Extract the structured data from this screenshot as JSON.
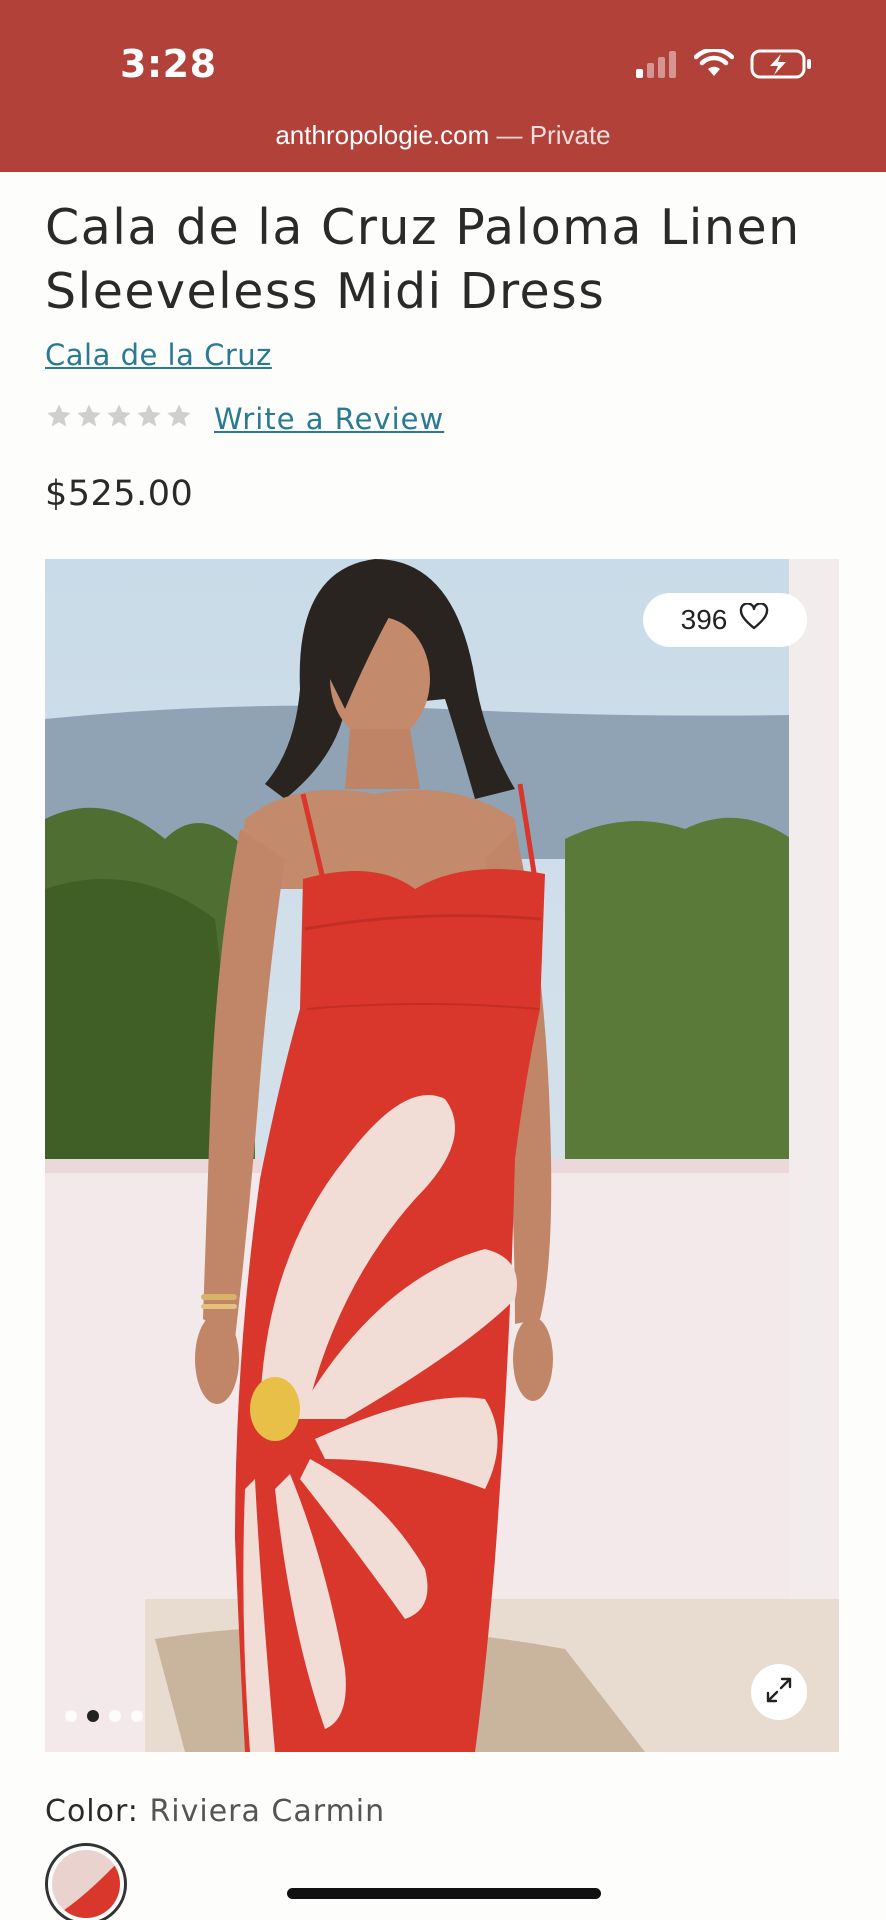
{
  "status_bar": {
    "time": "3:28"
  },
  "address_bar": {
    "host": "anthropologie.com",
    "suffix": " — Private"
  },
  "product": {
    "title": "Cala de la Cruz Paloma Linen Sleeveless Midi Dress",
    "brand": "Cala de la Cruz",
    "rating_stars": 0,
    "write_review": "Write a Review",
    "price": "$525.00"
  },
  "gallery": {
    "likes": "396",
    "slide_count": 4,
    "active_slide": 2
  },
  "color": {
    "label": "Color:",
    "value": "Riviera Carmin"
  },
  "colors": {
    "brand_bar": "#b2413a",
    "link": "#2a7a93",
    "dress_red": "#d9372b"
  }
}
